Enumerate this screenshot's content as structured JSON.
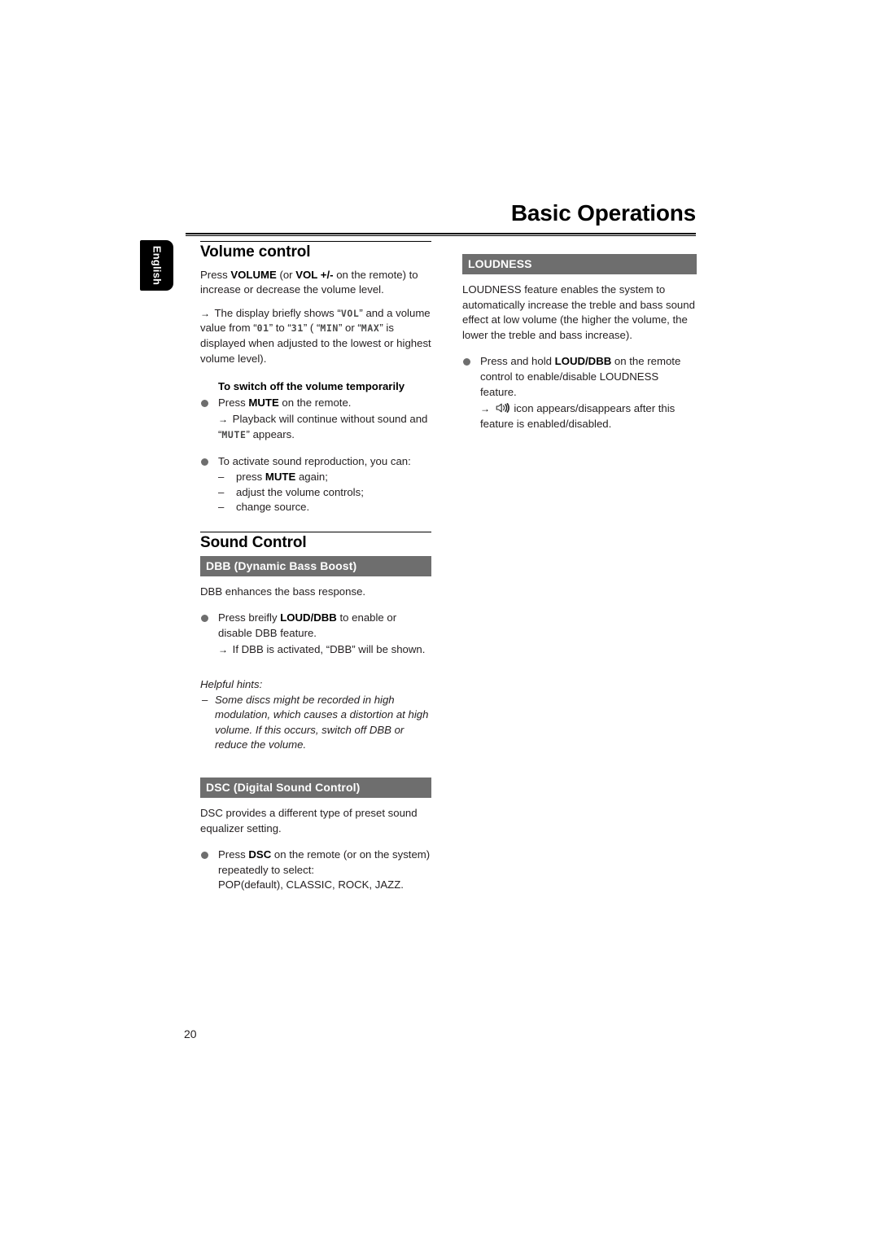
{
  "header": {
    "title": "Basic Operations"
  },
  "language_tab": {
    "label": "English"
  },
  "page_number": "20",
  "left_column": {
    "volume_section": {
      "heading": "Volume control",
      "para1_a": "Press ",
      "para1_volume": "VOLUME",
      "para1_b": " (or ",
      "para1_vol": "VOL +/-",
      "para1_c": " on the remote) to increase or decrease the volume level.",
      "arrow_glyph": "→",
      "para2_a": "The display briefly shows “",
      "para2_lcd_vol": "VOL",
      "para2_b": "” and a volume value from “",
      "para2_lcd_min_val": "01",
      "para2_c": "” to “",
      "para2_lcd_max_val": "31",
      "para2_d": "” ( “",
      "para2_lcd_min": "MIN",
      "para2_e": "” or “",
      "para2_lcd_max": "MAX",
      "para2_f": "” is displayed when adjusted to the lowest or highest volume level).",
      "mute_heading": "To switch off the volume temporarily",
      "mute_b1_a": "Press ",
      "mute_b1_bold": "MUTE",
      "mute_b1_b": " on the remote.",
      "mute_b1_arrow_a": "Playback will continue without sound and “",
      "mute_b1_lcd": "MUTE",
      "mute_b1_arrow_b": "” appears.",
      "mute_b2": "To activate sound reproduction, you can:",
      "mute_dash_glyph": "–",
      "mute_dash1_a": "press ",
      "mute_dash1_bold": "MUTE",
      "mute_dash1_b": " again;",
      "mute_dash2": "adjust the volume controls;",
      "mute_dash3": "change source."
    },
    "sound_section": {
      "heading": "Sound Control",
      "dbb_bar": "DBB (Dynamic Bass Boost)",
      "dbb_para": "DBB enhances the bass response.",
      "dbb_b1_a": "Press breifly ",
      "dbb_b1_bold": "LOUD/DBB",
      "dbb_b1_b": " to enable or disable DBB feature.",
      "dbb_b1_arrow": "If DBB is activated, “DBB” will be shown.",
      "hints_title": "Helpful hints:",
      "hints_dash": "–",
      "hints_body": "Some discs might be recorded in high modulation, which causes a distortion at high volume. If this occurs, switch off DBB or reduce the volume.",
      "dsc_bar": "DSC (Digital Sound Control)",
      "dsc_para": "DSC provides a different type of preset sound equalizer setting.",
      "dsc_b1_a": "Press ",
      "dsc_b1_bold": "DSC",
      "dsc_b1_b": " on the remote (or on the system) repeatedly to select:",
      "dsc_list": "POP(default), CLASSIC, ROCK, JAZZ."
    }
  },
  "right_column": {
    "loudness_bar": "LOUDNESS",
    "loudness_para": "LOUDNESS feature enables the system to automatically increase the treble and bass sound effect at low volume (the higher the volume, the lower the treble and bass increase).",
    "loudness_b1_a": "Press and hold ",
    "loudness_b1_bold": "LOUD/DBB",
    "loudness_b1_b": " on the remote control to enable/disable LOUDNESS feature.",
    "loudness_arrow_icon": "loudness-speaker-icon",
    "loudness_b1_arrow": "icon appears/disappears after this feature is enabled/disabled."
  },
  "colors": {
    "bar_gray": "#6e6e6e",
    "bullet_gray": "#6e6e6e",
    "text": "#231f20",
    "tab_black": "#000000"
  }
}
